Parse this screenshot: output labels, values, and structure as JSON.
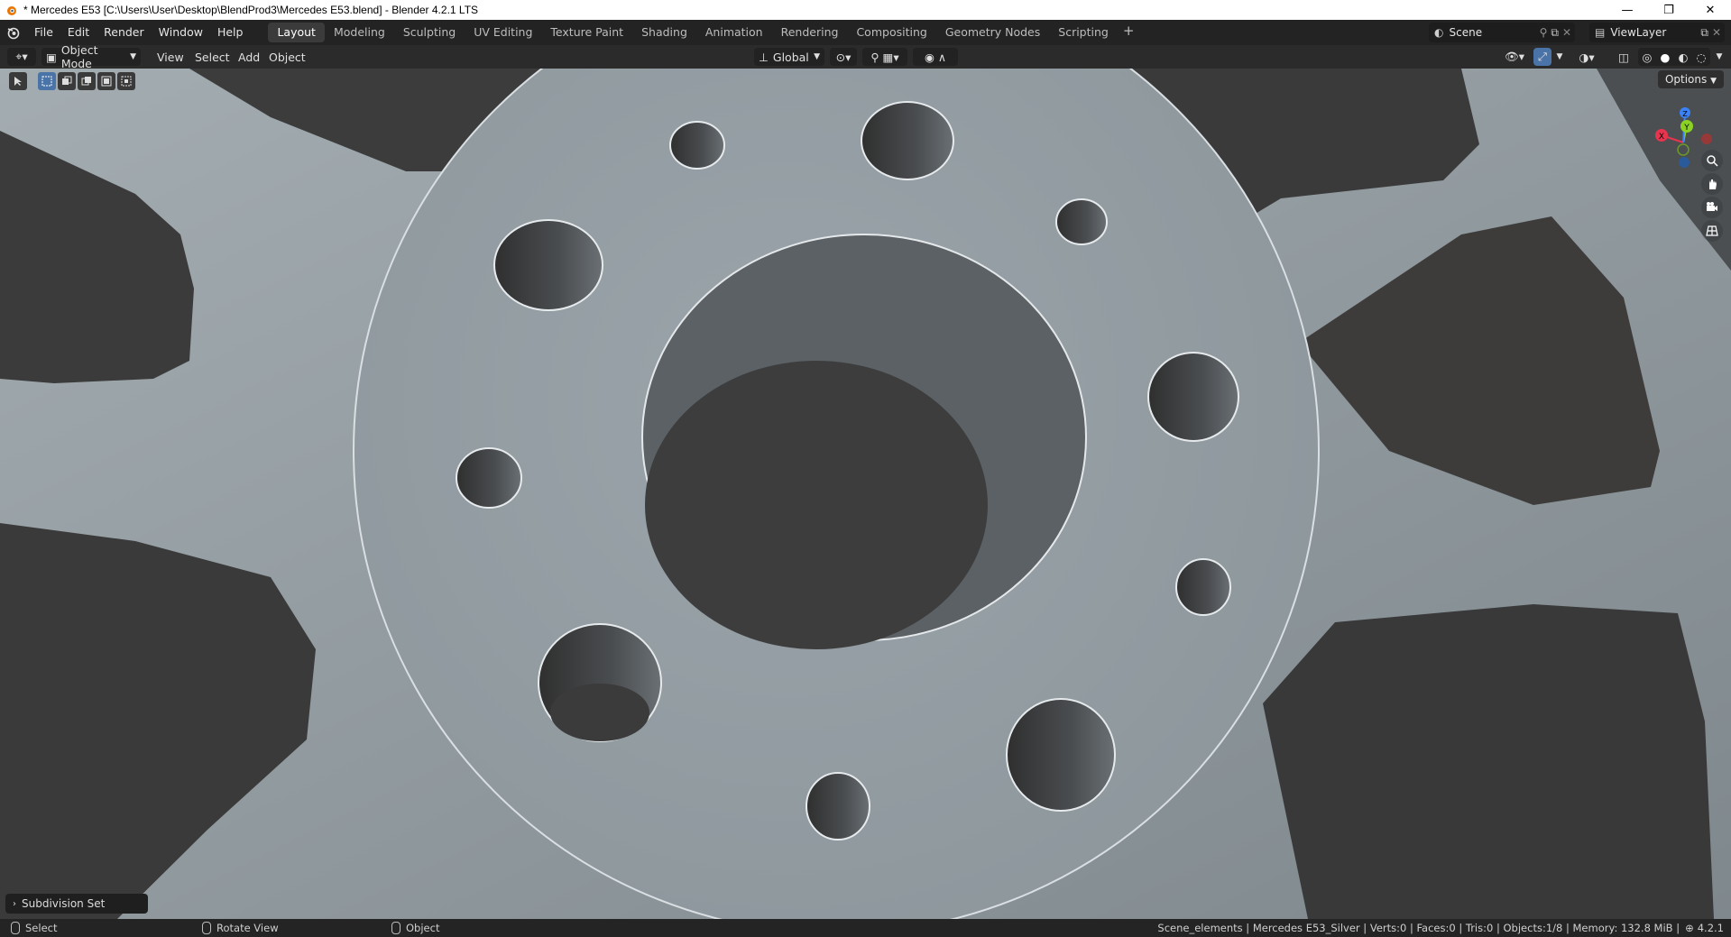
{
  "window": {
    "title": "* Mercedes E53 [C:\\Users\\User\\Desktop\\BlendProd3\\Mercedes E53.blend] - Blender 4.2.1 LTS",
    "minimize": "—",
    "maximize": "❐",
    "close": "✕"
  },
  "menu": [
    "File",
    "Edit",
    "Render",
    "Window",
    "Help"
  ],
  "workspaces": [
    "Layout",
    "Modeling",
    "Sculpting",
    "UV Editing",
    "Texture Paint",
    "Shading",
    "Animation",
    "Rendering",
    "Compositing",
    "Geometry Nodes",
    "Scripting"
  ],
  "active_workspace": "Layout",
  "scene": {
    "label": "Scene"
  },
  "view_layer": {
    "label": "ViewLayer"
  },
  "header": {
    "mode": "Object Mode",
    "menus": [
      "View",
      "Select",
      "Add",
      "Object"
    ],
    "transform_orientation": "Global"
  },
  "viewport": {
    "options_label": "Options",
    "gizmo": {
      "x": "X",
      "y": "Y",
      "z": "Z"
    },
    "colors": {
      "wheel": "#96a0a6",
      "hole": "#3d3d3d",
      "background": "#8f989d",
      "x_axis": "#e8344e",
      "y_axis": "#8bd225",
      "z_axis": "#3b82f6"
    }
  },
  "operator_panel": {
    "label": "Subdivision Set"
  },
  "status": {
    "left_action": "Select",
    "middle_action": "Rotate View",
    "right_action": "Object",
    "info": "Scene_elements | Mercedes E53_Silver | Verts:0 | Faces:0 | Tris:0 | Objects:1/8 | Memory: 132.8 MiB |",
    "version": "4.2.1"
  }
}
